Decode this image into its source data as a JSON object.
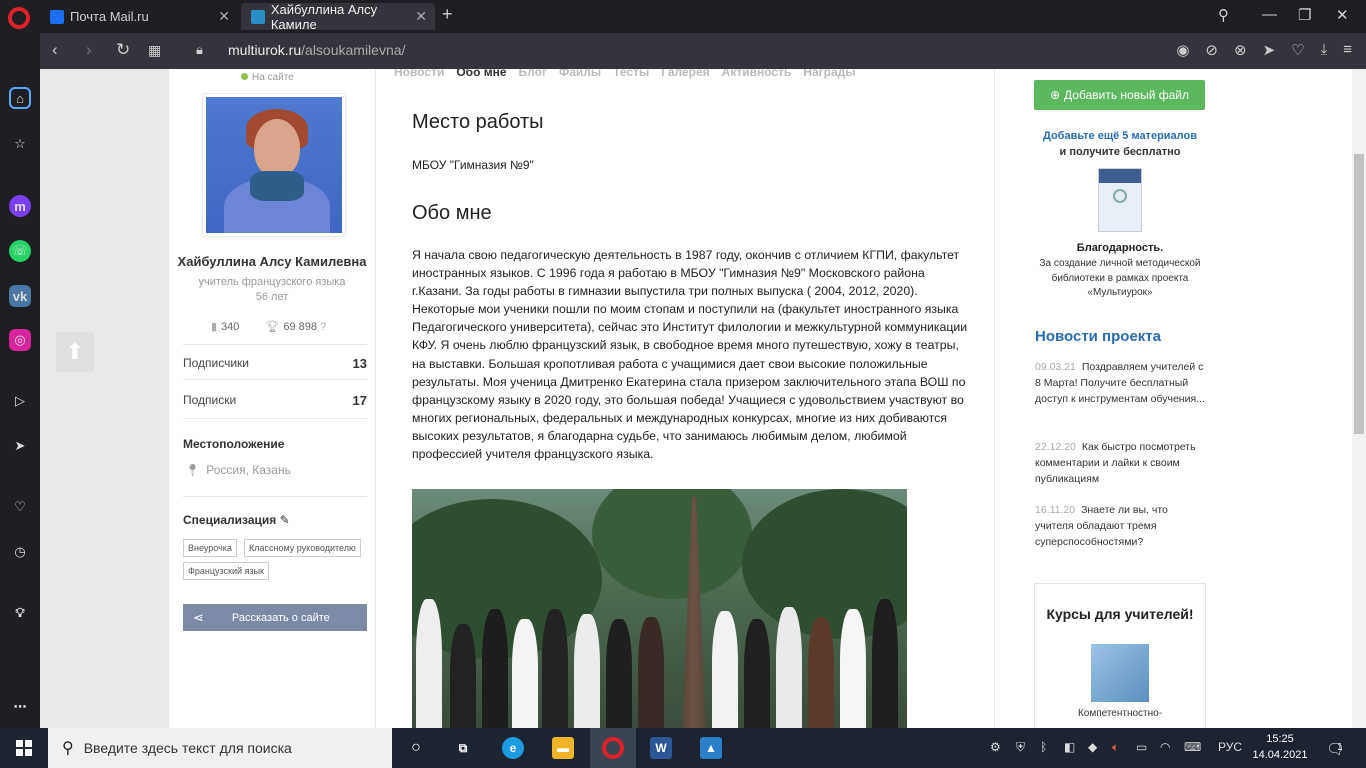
{
  "browser": {
    "tabs": [
      {
        "label": "Почта Mail.ru",
        "active": false
      },
      {
        "label": "Хайбуллина Алсу Камиле",
        "active": true
      }
    ],
    "url_host": "multiurok.ru",
    "url_path": "/alsoukamilevna/",
    "new_tab": "+"
  },
  "profile": {
    "status": "На сайте",
    "name": "Хайбуллина Алсу Камилевна",
    "role": "учитель французского языка",
    "age": "56 лет",
    "views": "340",
    "rating": "69 898",
    "subscribers_label": "Подписчики",
    "subscribers_count": "13",
    "subscriptions_label": "Подписки",
    "subscriptions_count": "17",
    "location_label": "Местоположение",
    "location": "Россия, Казань",
    "spec_label": "Специализация",
    "tags": [
      "Внеурочка",
      "Классному руководителю",
      "Французский язык"
    ],
    "share": "Рассказать о сайте"
  },
  "main": {
    "nav_tabs": [
      "Новости",
      "Обо мне",
      "Блог",
      "Файлы",
      "Тесты",
      "Галерея",
      "Активность",
      "Награды"
    ],
    "work_title": "Место работы",
    "work_place": "МБОУ \"Гимназия №9\"",
    "about_title": "Обо мне",
    "about_text": "Я начала свою педагогическую деятельность в 1987 году, окончив с отличием КГПИ, факультет иностранных языков. С 1996 года я работаю в МБОУ \"Гимназия №9\" Московского района г.Казани. За годы работы в гимназии выпустила три полных выпуска ( 2004, 2012, 2020). Некоторые мои ученики пошли по моим стопам и поступили на (факультет иностранного языка Педагогического университета), сейчас это Институт филологии и межкультурной коммуникации КФУ. Я очень люблю французский язык, в свободное время много путешествую, хожу в театры, на выставки. Большая кропотливая работа с учащимися дает свои высокие положильные результаты. Моя ученица Дмитренко Екатерина стала призером заключительного этапа ВОШ по французскому языку в 2020 году, это большая победа! Учащиеся с удовольствием участвуют во многих региональных, федеральных и международных конкурсах, многие из них добиваются высоких результатов, я благодарна судьбе, что занимаюсь любимым делом, любимой профессией учителя французского языка."
  },
  "right": {
    "add_button": "Добавить новый файл",
    "promo_line1": "Добавьте ещё 5 материалов",
    "promo_line2": "и получите бесплатно",
    "cert_title": "Благодарность.",
    "cert_desc": "За создание личной методической библиотеки в рамках проекта «Мультиурок»",
    "news_title": "Новости проекта",
    "news": [
      {
        "date": "09.03.21",
        "text": "Поздравляем учителей с 8 Марта! Получите бесплатный доступ к инструментам обучения..."
      },
      {
        "date": "22.12.20",
        "text": "Как быстро посмотреть комментарии и лайки к своим публикациям"
      },
      {
        "date": "16.11.20",
        "text": "Знаете ли вы, что учителя обладают тремя суперспособностями?"
      }
    ],
    "courses_title": "Курсы для учителей!",
    "courses_text": "Компетентностно-"
  },
  "taskbar": {
    "search_placeholder": "Введите здесь текст для поиска",
    "lang": "РУС",
    "time": "15:25",
    "date": "14.04.2021",
    "notifications": "1"
  },
  "colors": {
    "accent_green": "#5cb85c",
    "link_blue": "#2b6cb0",
    "opera_red": "#e0202a",
    "share_btn": "#7d8aa6"
  }
}
